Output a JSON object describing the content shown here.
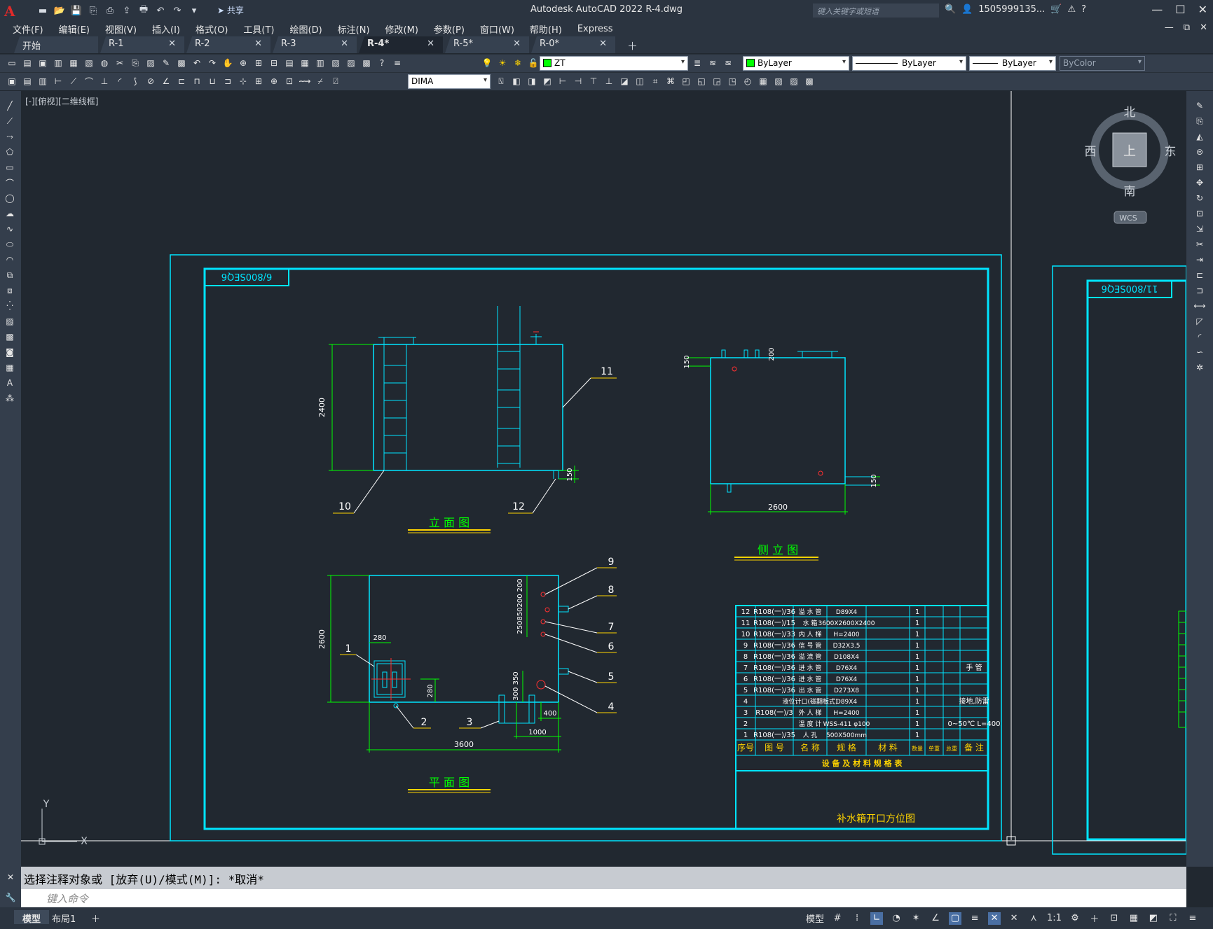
{
  "titlebar": {
    "app_letter": "A",
    "share_label": "共享",
    "title": "Autodesk AutoCAD 2022    R-4.dwg",
    "search_placeholder": "键入关键字或短语",
    "user": "1505999135...",
    "cart": "🛒",
    "help": "?"
  },
  "menu": [
    "文件(F)",
    "编辑(E)",
    "视图(V)",
    "插入(I)",
    "格式(O)",
    "工具(T)",
    "绘图(D)",
    "标注(N)",
    "修改(M)",
    "参数(P)",
    "窗口(W)",
    "帮助(H)",
    "Express"
  ],
  "tabs": [
    {
      "label": "开始",
      "active": false
    },
    {
      "label": "R-1",
      "active": false
    },
    {
      "label": "R-2",
      "active": false
    },
    {
      "label": "R-3",
      "active": false
    },
    {
      "label": "R-4*",
      "active": true
    },
    {
      "label": "R-5*",
      "active": false
    },
    {
      "label": "R-0*",
      "active": false
    }
  ],
  "toolbar": {
    "layer": "ZT",
    "color": "ByLayer",
    "linetype": "ByLayer",
    "lineweight": "ByLayer",
    "plotstyle": "ByColor",
    "dimstyle": "DIMA"
  },
  "viewport_label": "[-][俯视][二维线框]",
  "viewcube": {
    "north": "北",
    "south": "南",
    "east": "东",
    "west": "西",
    "face": "上",
    "wcs": "WCS"
  },
  "drawing": {
    "sheet1_tag": "6/800SEQ6",
    "sheet2_tag": "11/800SEQ6",
    "elevation_title": "立  面  图",
    "side_title": "侧  立  图",
    "plan_title": "平  面  图",
    "title_block": "补水箱开口方位图",
    "table_caption": "设 备 及 材 料 规 格 表",
    "dims": {
      "elev_height": "2400",
      "elev_150": "150",
      "side_150a": "150",
      "side_200": "200",
      "side_150b": "150",
      "side_width": "2600",
      "plan_height": "2600",
      "plan_280a": "280",
      "plan_280b": "280",
      "plan_200": "200",
      "plan_stack": "250850200",
      "plan_300_350": "300 350",
      "plan_400": "400",
      "plan_1000": "1000",
      "plan_3600": "3600"
    },
    "callouts": [
      "1",
      "2",
      "3",
      "4",
      "5",
      "6",
      "7",
      "8",
      "9",
      "10",
      "11",
      "12"
    ],
    "table_header": [
      "序号",
      "图  号",
      "名  称",
      "规  格",
      "材  料",
      "数量",
      "单重",
      "总重",
      "备  注"
    ],
    "table_rows": [
      [
        "12",
        "R108(一)/36",
        "溢 水 管",
        "D89X4",
        "",
        "1",
        "",
        ""
      ],
      [
        "11",
        "R108(一)/15",
        "水  箱",
        "3600X2600X2400",
        "",
        "1",
        "",
        ""
      ],
      [
        "10",
        "R108(一)/33",
        "内 人 梯",
        "H=2400",
        "",
        "1",
        "",
        ""
      ],
      [
        "9",
        "R108(一)/36",
        "信 号 管",
        "D32X3.5",
        "",
        "1",
        "",
        ""
      ],
      [
        "8",
        "R108(一)/36",
        "溢 流 管",
        "D108X4",
        "",
        "1",
        "",
        ""
      ],
      [
        "7",
        "R108(一)/36",
        "进 水 管",
        "D76X4",
        "",
        "1",
        "",
        "手 管"
      ],
      [
        "6",
        "R108(一)/36",
        "进 水 管",
        "D76X4",
        "",
        "1",
        "",
        ""
      ],
      [
        "5",
        "R108(一)/36",
        "出 水 管",
        "D273X8",
        "",
        "1",
        "",
        ""
      ],
      [
        "4",
        "",
        "液位计口(磁翻板式)",
        "D89X4",
        "",
        "1",
        "",
        "接地,防雷"
      ],
      [
        "3",
        "R108(一)/3",
        "外 人 梯",
        "H=2400",
        "",
        "1",
        "",
        ""
      ],
      [
        "2",
        "",
        "温  度  计",
        "WSS-411 φ100",
        "",
        "1",
        "",
        "0~50℃ L=400"
      ],
      [
        "1",
        "R108(一)/35",
        "人  孔",
        "500X500mm",
        "",
        "1",
        "",
        ""
      ]
    ]
  },
  "command": {
    "history": "选择注释对象或 [放弃(U)/模式(M)]: *取消*",
    "placeholder": "键入命令"
  },
  "layouts": [
    "模型",
    "布局1"
  ],
  "status": {
    "model": "模型",
    "scale": "1:1"
  }
}
